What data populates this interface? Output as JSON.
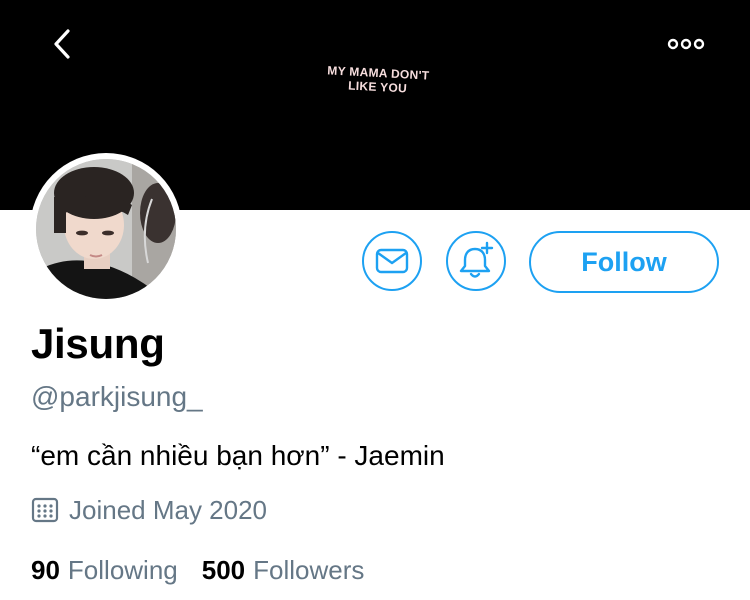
{
  "header": {
    "back_icon": "chevron-left-icon",
    "more_icon": "more-horizontal-icon",
    "banner_text": [
      "MY MAMA DON'T",
      "LIKE YOU"
    ]
  },
  "actions": {
    "message_icon": "envelope-icon",
    "notify_icon": "bell-plus-icon",
    "follow_label": "Follow"
  },
  "profile": {
    "name": "Jisung",
    "handle": "@parkjisung_",
    "bio": "“em cần nhiều bạn hơn” - Jaemin",
    "joined": "Joined May 2020",
    "joined_icon": "calendar-icon",
    "following_count": "90",
    "following_label": "Following",
    "followers_count": "500",
    "followers_label": "Followers"
  },
  "colors": {
    "accent": "#1da1f2",
    "muted_text": "#657786",
    "banner_bg": "#000000",
    "banner_text": "#f7dede"
  }
}
